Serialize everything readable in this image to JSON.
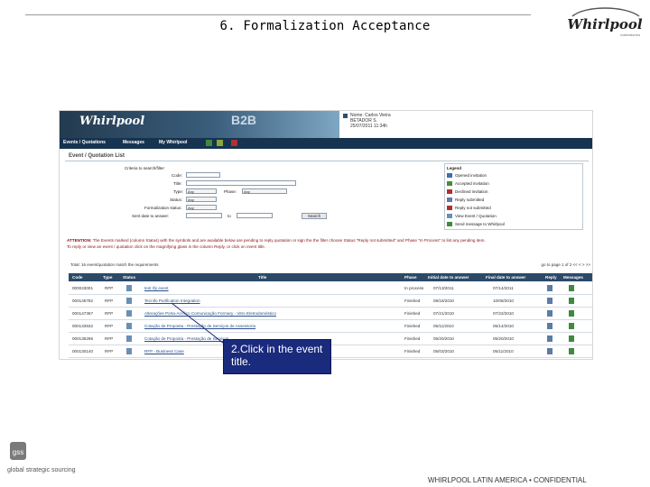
{
  "slide": {
    "title": "6. Formalization Acceptance",
    "brand_logo": "Whirlpool",
    "footer": "WHIRLPOOL LATIN AMERICA • CONFIDENTIAL",
    "gss_logo_text": "gss",
    "gss_caption": "global strategic sourcing"
  },
  "callout": {
    "text": "2.Click in the event title."
  },
  "screenshot": {
    "header": {
      "logo": "Whirlpool",
      "b2b_label": "B2B",
      "user_line1": "Nome: Carlos Vieira",
      "user_line2": "BETADOR S.",
      "user_line3": "25/07/2011 11:34h"
    },
    "nav": {
      "items": [
        "Events / Quotations",
        "Messages",
        "My Whirlpool"
      ]
    },
    "breadcrumb": "Event / Quotation  List",
    "criteria": {
      "heading": "Criteria to search/filter",
      "code_label": "Code:",
      "title_label": "Title:",
      "type_label": "Type:",
      "type_value": "Any",
      "phase_label": "Phase:",
      "phase_value": "Any",
      "status_label": "Status:",
      "status_value": "Any",
      "formalization_label": "Formalization status:",
      "formalization_value": "Any",
      "sent_label": "Sent date to answer:",
      "to_label": "to",
      "search_button": "Search"
    },
    "legend": {
      "title": "Legend",
      "items": [
        {
          "label": "Opened invitation",
          "color": "#3b6fb0"
        },
        {
          "label": "Accepted invitation",
          "color": "#4a8a3a"
        },
        {
          "label": "Declined invitation",
          "color": "#b03030"
        },
        {
          "label": "Reply submitted",
          "color": "#5a7ca6"
        },
        {
          "label": "Reply not submitted",
          "color": "#b03030"
        },
        {
          "label": "View Event / Quotation",
          "color": "#6a8fb5"
        },
        {
          "label": "Send message to Whirlpool",
          "color": "#3f8a3f"
        }
      ]
    },
    "attention": {
      "line1_lead": "ATTENTION:",
      "line1": "The Events marked (column Status) with the symbols  and  are available below are pending to reply quotation or sign the the filter choose Status \"Reply not submitted\" and Phase \"In Process\" to list any pending item.",
      "line2": "To reply or view an event / quotation click on the magnifying glass  in the column Reply, or click on event title."
    },
    "table": {
      "result_text": "Total: 16 event/quotation match the requirements",
      "pager_text": "go to page  1  of  2  << <  > >>",
      "headers": [
        "Code",
        "Type",
        "Status",
        "Title",
        "Phase",
        "Initial date to answer",
        "Final date to answer",
        "Reply",
        "Messages"
      ],
      "rows": [
        {
          "code": "000043001",
          "type": "RFP",
          "title": "test rfp event",
          "phase": "In process",
          "initial": "07/13/2011",
          "final": "07/14/2011"
        },
        {
          "code": "000145782",
          "type": "RFP",
          "title": "Tecnifo Purification Integration",
          "phase": "Finished",
          "initial": "08/18/2010",
          "final": "10/08/2010"
        },
        {
          "code": "000147367",
          "type": "RFP",
          "title": "Alterações Porta-Acrílico Comunicação Formary - Vitro Eletrodoméstico",
          "phase": "Finished",
          "initial": "07/21/2010",
          "final": "07/22/2010"
        },
        {
          "code": "000133932",
          "type": "RFP",
          "title": "Cotação de Proposta - Prestação de Serviços de Assessoria",
          "phase": "Finished",
          "initial": "05/11/2010",
          "final": "05/14/2010"
        },
        {
          "code": "000135296",
          "type": "RFP",
          "title": "Cotação de Proposta - Prestação de Serviços",
          "phase": "Finished",
          "initial": "05/20/2010",
          "final": "05/20/2010"
        },
        {
          "code": "000130140",
          "type": "RFP",
          "title": "RFP - Business Case",
          "phase": "Finished",
          "initial": "05/03/2010",
          "final": "05/11/2010"
        }
      ]
    }
  }
}
